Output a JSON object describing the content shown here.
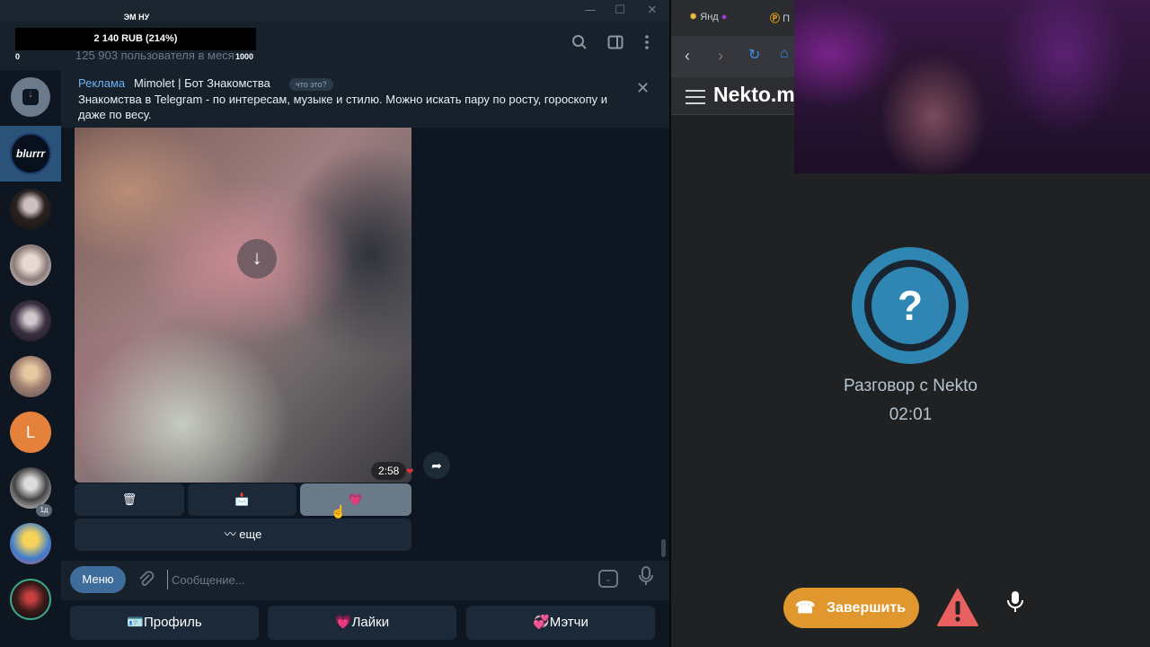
{
  "overlay": {
    "title": "ЭМ НУ",
    "progress_text": "2 140 RUB (214%)",
    "progress_min": "0",
    "progress_max": "1000"
  },
  "telegram": {
    "members_text": "125 903 пользователя в меся",
    "window_buttons": {
      "minimize": "—",
      "maximize": "☐",
      "close": "✕"
    },
    "header_icons": [
      "search-icon",
      "sidebar-toggle-icon",
      "more-icon"
    ],
    "sidebar": {
      "chats": [
        {
          "name": "blurrr",
          "label": "blurrr",
          "active": true
        },
        {
          "name": "chat-2"
        },
        {
          "name": "chat-3"
        },
        {
          "name": "chat-4"
        },
        {
          "name": "chat-5"
        },
        {
          "name": "chat-l",
          "label": "L",
          "badge": "1д"
        },
        {
          "name": "chat-7"
        },
        {
          "name": "chat-8"
        },
        {
          "name": "chat-9"
        }
      ]
    },
    "ad": {
      "label": "Реклама",
      "name": "Mimolet | Бот Знакомства",
      "what": "что это?",
      "text": "Знакомства в Telegram - по интересам, музыке и стилю. Можно искать пару по росту, гороскопу и даже по весу."
    },
    "message": {
      "time": "2:58",
      "reaction": "❤",
      "inline_buttons": [
        "🗑",
        "📩",
        "💗"
      ],
      "more_button": "〰 еще"
    },
    "composer": {
      "menu_label": "Меню",
      "placeholder": "Сообщение..."
    },
    "reply_keyboard": [
      "🪪Профиль",
      "💗Лайки",
      "💞Мэтчи"
    ]
  },
  "browser": {
    "tabs": [
      "Янд",
      "П"
    ],
    "site_name": "Nekto.m",
    "conversation_title": "Разговор с Nekto",
    "timer": "02:01",
    "end_button": "Завершить",
    "question_mark": "?"
  },
  "colors": {
    "telegram_bg": "#17212b",
    "telegram_chat_bg": "#0e1621",
    "accent_blue": "#3e6d9c",
    "nekto_blue": "#2f86b3",
    "end_orange": "#e0982e",
    "warn_red": "#e86060"
  }
}
